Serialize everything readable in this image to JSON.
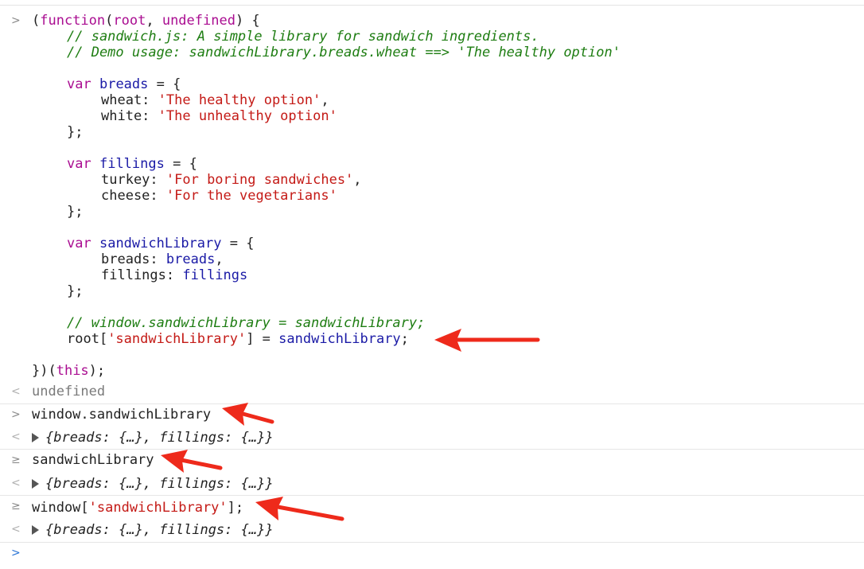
{
  "console": {
    "input_code": {
      "line1_a": "(",
      "line1_b": "function",
      "line1_c": "(",
      "line1_d": "root",
      "line1_e": ", ",
      "line1_f": "undefined",
      "line1_g": ") {",
      "comment1": "// sandwich.js: A simple library for sandwich ingredients.",
      "comment2": "// Demo usage: sandwichLibrary.breads.wheat ==> 'The healthy option'",
      "var_kw": "var",
      "breads_name": "breads",
      "eq_open": " = {",
      "wheat_key": "wheat: ",
      "wheat_val": "'The healthy option'",
      "comma": ",",
      "white_key": "white: ",
      "white_val": "'The unhealthy option'",
      "close": "};",
      "fillings_name": "fillings",
      "turkey_key": "turkey: ",
      "turkey_val": "'For boring sandwiches'",
      "cheese_key": "cheese: ",
      "cheese_val": "'For the vegetarians'",
      "library_name": "sandwichLibrary",
      "breads_key": "breads: ",
      "breads_ref": "breads",
      "fillings_key": "fillings: ",
      "fillings_ref": "fillings",
      "comment3": "// window.sandwichLibrary = sandwichLibrary;",
      "root_a": "root[",
      "root_b": "'sandwichLibrary'",
      "root_c": "] = ",
      "root_d": "sandwichLibrary",
      "root_e": ";",
      "end_a": "})(",
      "end_b": "this",
      "end_c": ");"
    },
    "result1": "undefined",
    "cmd2": "window.sandwichLibrary",
    "result2": "{breads: {…}, fillings: {…}}",
    "cmd3": "sandwichLibrary",
    "result3": "{breads: {…}, fillings: {…}}",
    "cmd4_a": "window[",
    "cmd4_b": "'sandwichLibrary'",
    "cmd4_c": "];",
    "result4": "{breads: {…}, fillings: {…}}",
    "prompt_input": ">",
    "prompt_output": "<",
    "prompt_history": "≥"
  },
  "colors": {
    "arrow": "#ee2a1b"
  }
}
